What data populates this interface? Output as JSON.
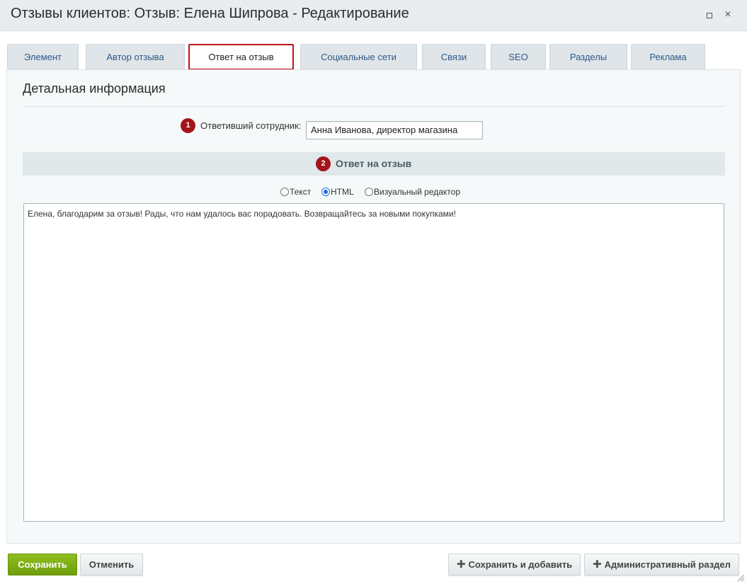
{
  "window": {
    "title": "Отзывы клиентов: Отзыв: Елена Шипрова - Редактирование",
    "maximize_icon": "maximize-icon",
    "close_icon": "close-icon",
    "close_glyph": "×"
  },
  "tabs": [
    {
      "label": "Элемент"
    },
    {
      "label": "Автор отзыва"
    },
    {
      "label": "Ответ на отзыв",
      "active": true
    },
    {
      "label": "Социальные сети"
    },
    {
      "label": "Связи"
    },
    {
      "label": "SEO"
    },
    {
      "label": "Разделы"
    },
    {
      "label": "Реклама"
    }
  ],
  "section": {
    "title": "Детальная информация"
  },
  "responder": {
    "badge": "1",
    "label": "Ответивший сотрудник:",
    "value": "Анна Иванова, директор магазина"
  },
  "reply_block": {
    "badge": "2",
    "title": "Ответ на отзыв",
    "mode_options": [
      {
        "label": "Текст",
        "checked": false
      },
      {
        "label": "HTML",
        "checked": true
      },
      {
        "label": "Визуальный редактор",
        "checked": false
      }
    ],
    "text": "Елена, благодарим за отзыв! Рады, что нам удалось вас порадовать. Возвращайтесь за новыми покупками!"
  },
  "footer": {
    "save_label": "Сохранить",
    "cancel_label": "Отменить",
    "save_add_label": "Сохранить и добавить",
    "admin_label": "Административный раздел",
    "plus_glyph": "✚"
  },
  "colors": {
    "accent_red": "#a4141b",
    "save_green": "#7aab12",
    "tab_text": "#2e5a8a"
  }
}
